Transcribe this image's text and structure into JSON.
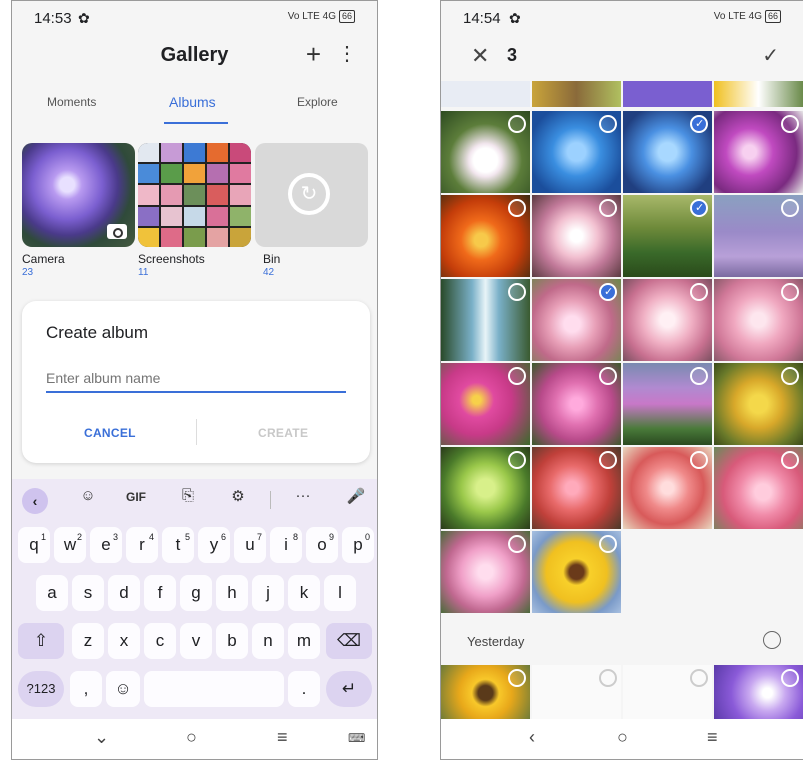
{
  "left": {
    "status": {
      "time": "14:53",
      "sys": "Vo LTE 4G",
      "battery": "66"
    },
    "title": "Gallery",
    "tabs": [
      "Moments",
      "Albums",
      "Explore"
    ],
    "albums": [
      {
        "name": "Camera",
        "count": "23"
      },
      {
        "name": "Screenshots",
        "count": "11"
      },
      {
        "name": "Bin",
        "count": "42"
      }
    ],
    "dialog": {
      "title": "Create album",
      "placeholder": "Enter album name",
      "cancel": "CANCEL",
      "create": "CREATE"
    },
    "keyboard": {
      "toolbar": {
        "gif": "GIF",
        "more": "···"
      },
      "row1": [
        "q",
        "w",
        "e",
        "r",
        "t",
        "y",
        "u",
        "i",
        "o",
        "p"
      ],
      "row1_hints": [
        "1",
        "2",
        "3",
        "4",
        "5",
        "6",
        "7",
        "8",
        "9",
        "0"
      ],
      "row2": [
        "a",
        "s",
        "d",
        "f",
        "g",
        "h",
        "j",
        "k",
        "l"
      ],
      "row3": [
        "z",
        "x",
        "c",
        "v",
        "b",
        "n",
        "m"
      ],
      "sym": "?123",
      "comma": ",",
      "period": "."
    }
  },
  "right": {
    "status": {
      "time": "14:54",
      "sys": "Vo LTE 4G",
      "battery": "66"
    },
    "selected_count": "3",
    "section": "Yesterday",
    "accent": "#3a6fd8"
  }
}
